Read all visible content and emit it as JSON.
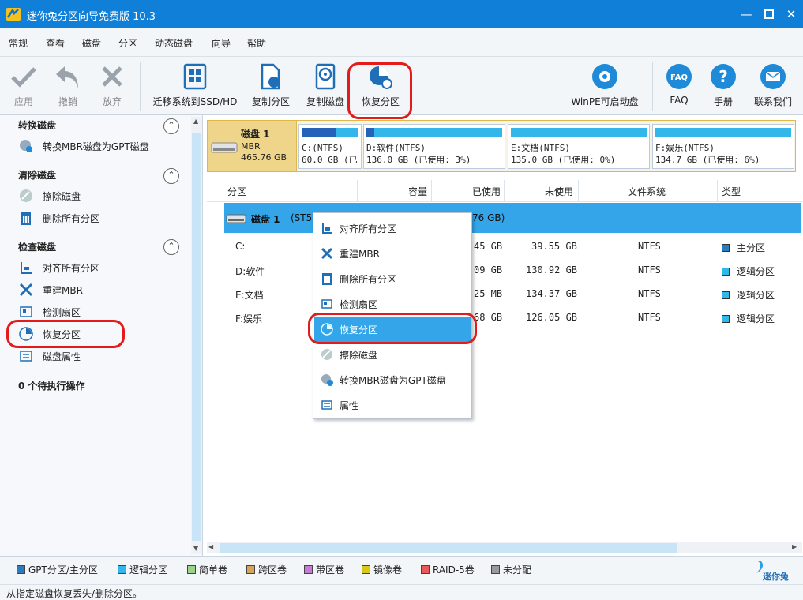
{
  "window": {
    "title": "迷你兔分区向导免费版 10.3",
    "buttons": [
      "minimize",
      "maximize",
      "close"
    ]
  },
  "menu": [
    "常规",
    "查看",
    "磁盘",
    "分区",
    "动态磁盘",
    "向导",
    "帮助"
  ],
  "toolbar": {
    "apply": "应用",
    "undo": "撤销",
    "discard": "放弃",
    "migrate": "迁移系统到SSD/HD",
    "copy_partition": "复制分区",
    "copy_disk": "复制磁盘",
    "recover_partition": "恢复分区",
    "winpe": "WinPE可启动盘",
    "faq": "FAQ",
    "manual": "手册",
    "contact": "联系我们"
  },
  "sidebar": {
    "convert": {
      "title": "转换磁盘",
      "items": [
        "转换MBR磁盘为GPT磁盘"
      ]
    },
    "clean": {
      "title": "清除磁盘",
      "items": [
        "擦除磁盘",
        "删除所有分区"
      ]
    },
    "check": {
      "title": "检查磁盘",
      "items": [
        "对齐所有分区",
        "重建MBR",
        "检测扇区",
        "恢复分区",
        "磁盘属性"
      ]
    },
    "pending": "0 个待执行操作"
  },
  "disk_map": {
    "disk_name": "磁盘 1",
    "disk_type": "MBR",
    "disk_size": "465.76 GB",
    "partitions": [
      {
        "line1": "C:(NTFS)",
        "line2": "60.0 GB (已",
        "used_fraction": 0.6
      },
      {
        "line1": "D:软件(NTFS)",
        "line2": "136.0 GB (已使用: 3%)",
        "used_fraction": 0.03
      },
      {
        "line1": "E:文档(NTFS)",
        "line2": "135.0 GB (已使用: 0%)",
        "used_fraction": 0.0
      },
      {
        "line1": "F:娱乐(NTFS)",
        "line2": "134.7 GB (已使用: 6%)",
        "used_fraction": 0.06
      }
    ]
  },
  "table": {
    "headers": [
      "分区",
      "容量",
      "已使用",
      "未使用",
      "文件系统",
      "类型"
    ],
    "disk_row": {
      "label": "磁盘 1",
      "detail_left": "(ST5",
      "detail_right": "76 GB)"
    },
    "rows": [
      {
        "name": "C:",
        "used": "45 GB",
        "unused": "39.55 GB",
        "fs": "NTFS",
        "type": "主分区",
        "type_color": "#2b7bbf"
      },
      {
        "name": "D:软件",
        "used": "09 GB",
        "unused": "130.92 GB",
        "fs": "NTFS",
        "type": "逻辑分区",
        "type_color": "#33b7ea"
      },
      {
        "name": "E:文档",
        "used": "25 MB",
        "unused": "134.37 GB",
        "fs": "NTFS",
        "type": "逻辑分区",
        "type_color": "#33b7ea"
      },
      {
        "name": "F:娱乐",
        "used": "68 GB",
        "unused": "126.05 GB",
        "fs": "NTFS",
        "type": "逻辑分区",
        "type_color": "#33b7ea"
      }
    ]
  },
  "context_menu": {
    "items": [
      "对齐所有分区",
      "重建MBR",
      "删除所有分区",
      "检测扇区",
      "恢复分区",
      "擦除磁盘",
      "转换MBR磁盘为GPT磁盘",
      "属性"
    ],
    "selected": "恢复分区"
  },
  "legend": [
    {
      "label": "GPT分区/主分区",
      "color": "#2b7bbf"
    },
    {
      "label": "逻辑分区",
      "color": "#33b7ea"
    },
    {
      "label": "简单卷",
      "color": "#9bd38d"
    },
    {
      "label": "跨区卷",
      "color": "#d8a458"
    },
    {
      "label": "带区卷",
      "color": "#c87ad6"
    },
    {
      "label": "镜像卷",
      "color": "#d8c81a"
    },
    {
      "label": "RAID-5卷",
      "color": "#e85a5a"
    },
    {
      "label": "未分配",
      "color": "#9a9a9a"
    }
  ],
  "brand": "迷你兔",
  "status": "从指定磁盘恢复丢失/删除分区。",
  "colors": {
    "accent": "#0f7fd8",
    "selection": "#33a5e8",
    "highlight_ring": "#e21b1b"
  }
}
